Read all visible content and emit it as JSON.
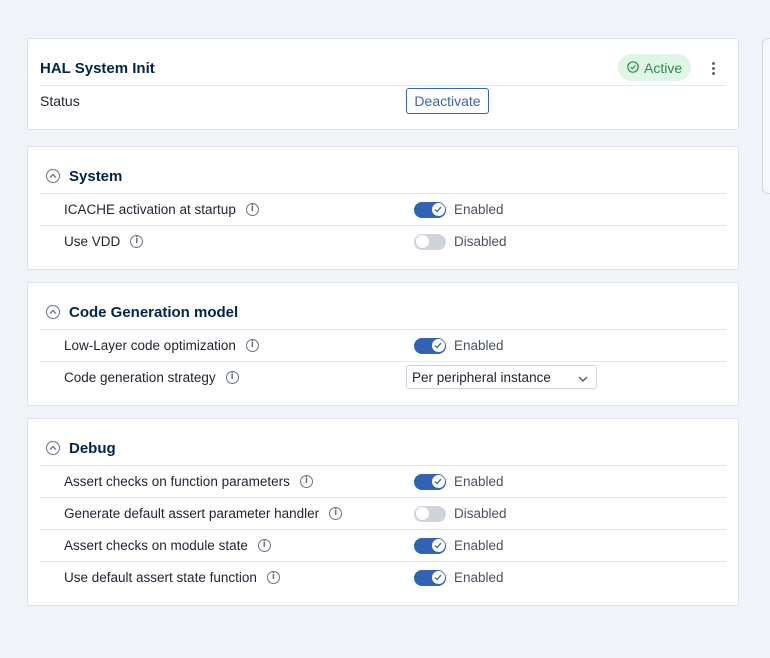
{
  "header": {
    "title": "HAL System Init",
    "status_badge": "Active",
    "status_label": "Status",
    "deactivate_label": "Deactivate"
  },
  "sections": {
    "system": {
      "title": "System",
      "rows": [
        {
          "label": "ICACHE activation at startup",
          "state": "Enabled"
        },
        {
          "label": "Use VDD",
          "state": "Disabled"
        }
      ]
    },
    "codegen": {
      "title": "Code Generation model",
      "rows": [
        {
          "label": "Low-Layer code optimization",
          "state": "Enabled"
        },
        {
          "label": "Code generation strategy",
          "value": "Per peripheral instance"
        }
      ]
    },
    "debug": {
      "title": "Debug",
      "rows": [
        {
          "label": "Assert checks on function parameters",
          "state": "Enabled"
        },
        {
          "label": "Generate default assert parameter handler",
          "state": "Disabled"
        },
        {
          "label": "Assert checks on module state",
          "state": "Enabled"
        },
        {
          "label": "Use default assert state function",
          "state": "Enabled"
        }
      ]
    }
  },
  "icons": {
    "badge": "check-circle-icon",
    "menu": "kebab-menu-icon",
    "collapse": "chevron-up-circle-icon",
    "info": "info-icon",
    "dropdown": "chevron-down-icon"
  },
  "colors": {
    "accent": "#3162b3",
    "active_badge_bg": "#dff5e6",
    "active_badge_text": "#2c8a4a",
    "toggle_off": "#cfd4dc"
  }
}
